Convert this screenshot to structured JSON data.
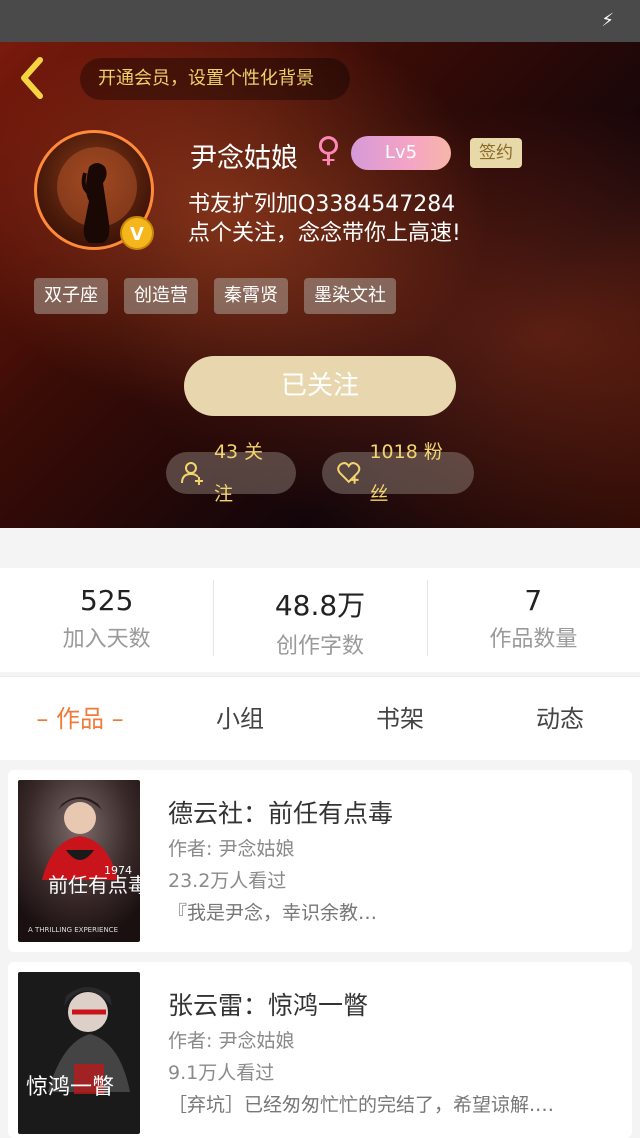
{
  "header": {
    "vip_banner": "开通会员，设置个性化背景",
    "username": "尹念姑娘",
    "gender_symbol": "♀",
    "level": "Lv5",
    "sign_badge": "签约",
    "verified_badge": "V",
    "bio_line1": "书友扩列加Q3384547284",
    "bio_line2": "点个关注，念念带你上高速!",
    "tags": [
      "双子座",
      "创造营",
      "秦霄贤",
      "墨染文社"
    ],
    "follow_button": "已关注",
    "following_label": "43 关注",
    "fans_label": "1018 粉丝"
  },
  "stats": [
    {
      "value": "525",
      "label": "加入天数"
    },
    {
      "value": "48.8万",
      "label": "创作字数"
    },
    {
      "value": "7",
      "label": "作品数量"
    }
  ],
  "tabs": [
    "– 作品 –",
    "小组",
    "书架",
    "动态"
  ],
  "works": [
    {
      "title": "德云社：前任有点毒",
      "author": "作者: 尹念姑娘",
      "views": "23.2万人看过",
      "desc": "『我是尹念，幸识余教…",
      "cover_text": "前任有点毒",
      "cover_year": "1974",
      "cover_sub": "A THRILLING EXPERIENCE"
    },
    {
      "title": "张云雷：惊鸿一瞥",
      "author": "作者: 尹念姑娘",
      "views": "9.1万人看过",
      "desc": "［弃坑］已经匆匆忙忙的完结了，希望谅解.…",
      "cover_text": "惊鸿一瞥"
    }
  ],
  "colors": {
    "accent": "#f07a3a",
    "gold": "#f3d56e",
    "follow_button": "#e8d7ae"
  }
}
